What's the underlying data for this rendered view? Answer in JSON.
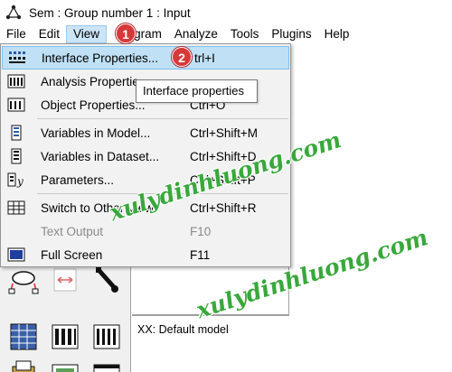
{
  "titlebar": {
    "title": "Sem : Group number 1 : Input",
    "icon": "network-diagram-icon"
  },
  "menubar": {
    "items": [
      "File",
      "Edit",
      "View",
      "gram",
      "Analyze",
      "Tools",
      "Plugins",
      "Help"
    ],
    "active": "View"
  },
  "view_menu": {
    "items": [
      {
        "icon": "interface-properties-icon",
        "label": "Interface Properties...",
        "shortcut": "trl+I",
        "highlighted": true
      },
      {
        "icon": "analysis-properties-icon",
        "label": "Analysis Propertie",
        "shortcut": ""
      },
      {
        "icon": "object-properties-icon",
        "label": "Object Properties...",
        "shortcut": "Ctrl+O"
      },
      {
        "icon": "variables-in-model-icon",
        "label": "Variables in Model...",
        "shortcut": "Ctrl+Shift+M"
      },
      {
        "icon": "variables-in-dataset-icon",
        "label": "Variables in Dataset...",
        "shortcut": "Ctrl+Shift+D"
      },
      {
        "icon": "parameters-icon",
        "label": "Parameters...",
        "shortcut": "Ctrl+Shift+P"
      },
      {
        "icon": "switch-view-icon",
        "label": "Switch to Other View",
        "shortcut": "Ctrl+Shift+R"
      },
      {
        "icon": "",
        "label": "Text Output",
        "shortcut": "F10",
        "disabled": true
      },
      {
        "icon": "full-screen-icon",
        "label": "Full Screen",
        "shortcut": "F11"
      }
    ]
  },
  "tooltip": {
    "text": "Interface properties"
  },
  "annotations": {
    "step1": "1",
    "step2": "2"
  },
  "model_panel": {
    "label": "XX: Default model"
  },
  "watermark": {
    "text": "xulydinhluong.com"
  },
  "colors": {
    "highlight": "#bfe0f5",
    "badge": "#d6393a",
    "watermark": "#39a83c"
  }
}
